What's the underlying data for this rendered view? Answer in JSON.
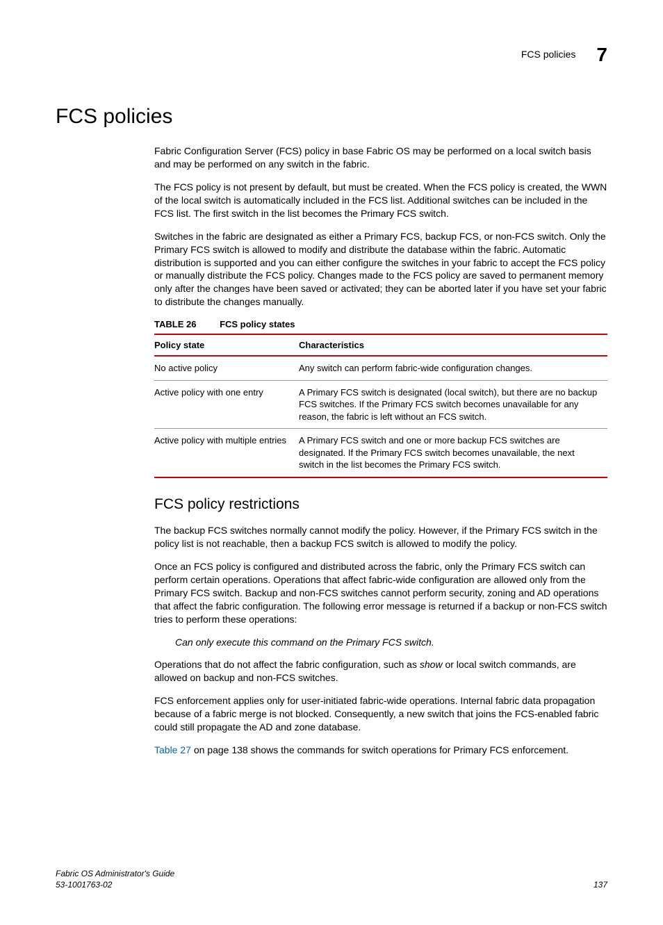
{
  "header": {
    "section": "FCS policies",
    "chapter": "7"
  },
  "title": "FCS policies",
  "paragraphs": {
    "p1": "Fabric Configuration Server (FCS) policy in base Fabric OS may be performed on a local switch basis and may be performed on any switch in the fabric.",
    "p2": "The FCS policy is not present by default, but must be created. When the FCS policy is created, the WWN of the local switch is automatically included in the FCS list. Additional switches can be included in the FCS list. The first switch in the list becomes the Primary FCS switch.",
    "p3": "Switches in the fabric are designated as either a Primary FCS, backup FCS, or non-FCS switch. Only the Primary FCS switch is allowed to modify and distribute the database within the fabric. Automatic distribution is supported and you can either configure the switches in your fabric to accept the FCS policy or manually distribute the FCS policy. Changes made to the FCS policy are saved to permanent memory only after the changes have been saved or activated; they can be aborted later if you have set your fabric to distribute the changes manually."
  },
  "table": {
    "label": "TABLE 26",
    "title": "FCS policy states",
    "headers": {
      "c1": "Policy state",
      "c2": "Characteristics"
    },
    "rows": [
      {
        "c1": "No active policy",
        "c2": "Any switch can perform fabric-wide configuration changes."
      },
      {
        "c1": "Active policy with one entry",
        "c2": "A Primary FCS switch is designated (local switch), but there are no backup FCS switches. If the Primary FCS switch becomes unavailable for any reason, the fabric is left without an FCS switch."
      },
      {
        "c1": "Active policy with multiple entries",
        "c2": "A Primary FCS switch and one or more backup FCS switches are designated. If the Primary FCS switch becomes unavailable, the next switch in the list becomes the Primary FCS switch."
      }
    ]
  },
  "subheading": "FCS policy restrictions",
  "restrictions": {
    "p1": "The backup FCS switches normally cannot modify the policy. However, if the Primary FCS switch in the policy list is not reachable, then a backup FCS switch is allowed to modify the policy.",
    "p2": "Once an FCS policy is configured and distributed across the fabric, only the Primary FCS switch can perform certain operations. Operations that affect fabric-wide configuration are allowed only from the Primary FCS switch. Backup and non-FCS switches cannot perform security, zoning and AD operations that affect the fabric configuration. The following error message is returned if a backup or non-FCS switch tries to perform these operations:",
    "quote": "Can only execute this command on the Primary FCS switch.",
    "p3a": "Operations that do not affect the fabric configuration, such as ",
    "p3_em": "show",
    "p3b": " or local switch commands, are allowed on backup and non-FCS switches.",
    "p4": "FCS enforcement applies only for user-initiated fabric-wide operations. Internal fabric data propagation because of a fabric merge is not blocked. Consequently, a new switch that joins the FCS-enabled fabric could still propagate the AD and zone database.",
    "p5_link": "Table 27",
    "p5_rest": " on page 138 shows the commands for switch operations for Primary FCS enforcement."
  },
  "footer": {
    "doc": "Fabric OS Administrator's Guide",
    "num": "53-1001763-02",
    "page": "137"
  }
}
